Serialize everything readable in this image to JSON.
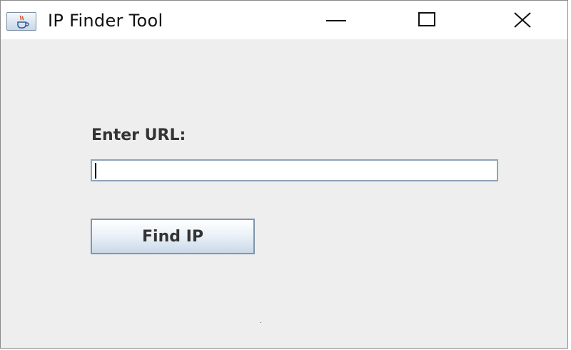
{
  "window": {
    "title": "IP Finder Tool",
    "app_icon": "java-cup-icon",
    "controls": {
      "minimize_icon": "minimize-icon",
      "maximize_icon": "maximize-icon",
      "close_icon": "close-icon"
    }
  },
  "form": {
    "url_label": "Enter URL:",
    "url_value": "",
    "url_placeholder": "",
    "find_button_label": "Find IP"
  },
  "colors": {
    "background": "#eeeeee",
    "titlebar": "#ffffff",
    "input_border": "#8fa3b8",
    "button_border": "#7f95ad"
  }
}
